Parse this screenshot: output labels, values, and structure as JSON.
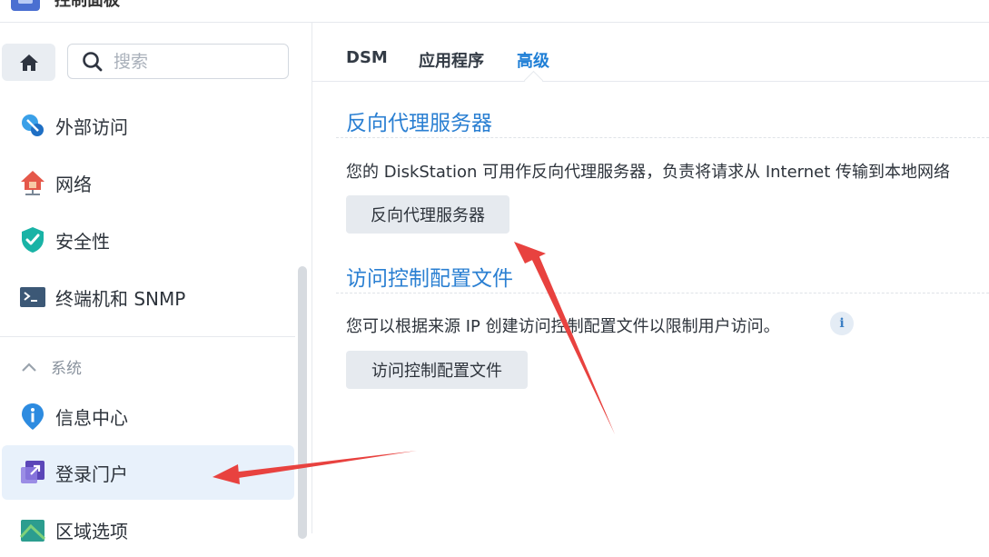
{
  "app": {
    "title": "控制面板"
  },
  "search": {
    "placeholder": "搜索"
  },
  "sidebar": {
    "items": [
      {
        "label": "外部访问",
        "icon": "external-access-icon"
      },
      {
        "label": "网络",
        "icon": "network-icon"
      },
      {
        "label": "安全性",
        "icon": "security-shield-icon"
      },
      {
        "label": "终端机和 SNMP",
        "icon": "terminal-icon"
      }
    ],
    "section": {
      "label": "系统",
      "icon": "chevron-up-icon"
    },
    "system_items": [
      {
        "label": "信息中心",
        "icon": "info-pin-icon"
      },
      {
        "label": "登录门户",
        "icon": "login-portal-icon",
        "active": true
      },
      {
        "label": "区域选项",
        "icon": "regional-options-icon"
      }
    ]
  },
  "tabs": [
    {
      "label": "DSM"
    },
    {
      "label": "应用程序"
    },
    {
      "label": "高级",
      "active": true
    }
  ],
  "reverse_proxy": {
    "title": "反向代理服务器",
    "description": "您的 DiskStation 可用作反向代理服务器，负责将请求从 Internet 传输到本地网络",
    "button_label": "反向代理服务器"
  },
  "access_control": {
    "title": "访问控制配置文件",
    "description": "您可以根据来源 IP 创建访问控制配置文件以限制用户访问。",
    "button_label": "访问控制配置文件"
  },
  "colors": {
    "accent": "#1f7fd6",
    "annotation_arrow": "#e8423f",
    "active_nav_bg": "#e8f1fb"
  }
}
